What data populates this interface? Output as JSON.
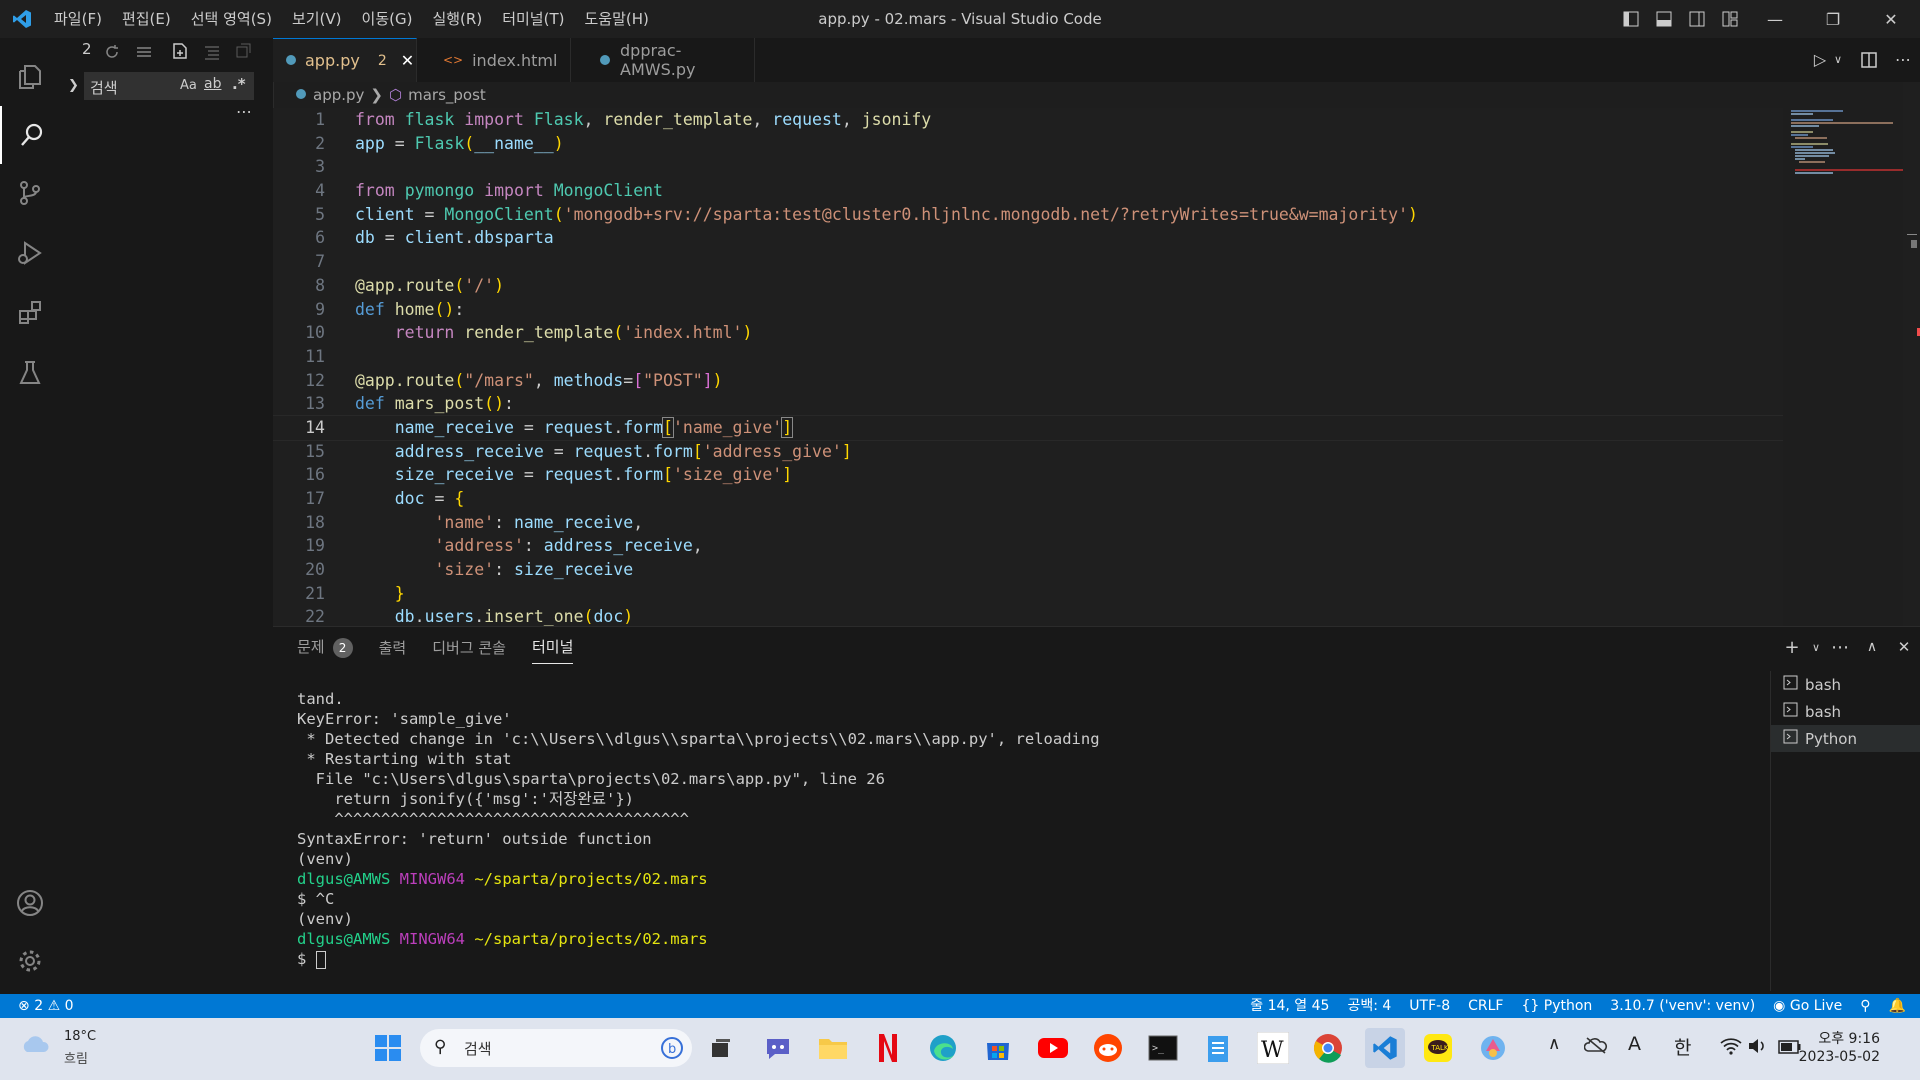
{
  "menu": [
    "파일(F)",
    "편집(E)",
    "선택 영역(S)",
    "보기(V)",
    "이동(G)",
    "실행(R)",
    "터미널(T)",
    "도움말(H)"
  ],
  "window_title": "app.py - 02.mars - Visual Studio Code",
  "sidebar": {
    "search_placeholder": "검색",
    "case": "Aa",
    "word": "ab",
    "regex": ".*",
    "more": "⋯"
  },
  "tabs": [
    {
      "label": "app.py",
      "problems": "2"
    },
    {
      "label": "index.html"
    },
    {
      "label": "dpprac-AMWS.py"
    }
  ],
  "breadcrumb": {
    "file": "app.py",
    "symbol": "mars_post"
  },
  "panel_tabs": {
    "problems": "문제",
    "problems_count": "2",
    "output": "출력",
    "debug": "디버그 콘솔",
    "terminal": "터미널"
  },
  "terminal_list": [
    "bash",
    "bash",
    "Python"
  ],
  "terminal_lines": [
    {
      "text": "tand."
    },
    {
      "text": "KeyError: 'sample_give'"
    },
    {
      "text": " * Detected change in 'c:\\\\Users\\\\dlgus\\\\sparta\\\\projects\\\\02.mars\\\\app.py', reloading"
    },
    {
      "text": " * Restarting with stat"
    },
    {
      "text": "  File \"c:\\Users\\dlgus\\sparta\\projects\\02.mars\\app.py\", line 26"
    },
    {
      "text": "    return jsonify({'msg':'저장완료'})"
    },
    {
      "text": "    ^^^^^^^^^^^^^^^^^^^^^^^^^^^^^^^^^^^^^^"
    },
    {
      "text": "SyntaxError: 'return' outside function"
    },
    {
      "text": "(venv)"
    },
    {
      "user": "dlgus@AMWS",
      "sys": "MINGW64",
      "path": "~/sparta/projects/02.mars"
    },
    {
      "text": "$ ^C"
    },
    {
      "text": "(venv)"
    },
    {
      "user": "dlgus@AMWS",
      "sys": "MINGW64",
      "path": "~/sparta/projects/02.mars"
    },
    {
      "text": "$ "
    }
  ],
  "status": {
    "errors": "2",
    "warnings": "0",
    "position": "줄 14, 열 45",
    "spaces": "공백: 4",
    "encoding": "UTF-8",
    "eol": "CRLF",
    "language": "Python",
    "interpreter": "3.10.7 ('venv': venv)",
    "golive": "Go Live"
  },
  "taskbar": {
    "temp": "18°C",
    "weather": "흐림",
    "search": "검색",
    "time": "오후 9:16",
    "date": "2023-05-02",
    "ime_a": "A",
    "ime_han": "한"
  }
}
